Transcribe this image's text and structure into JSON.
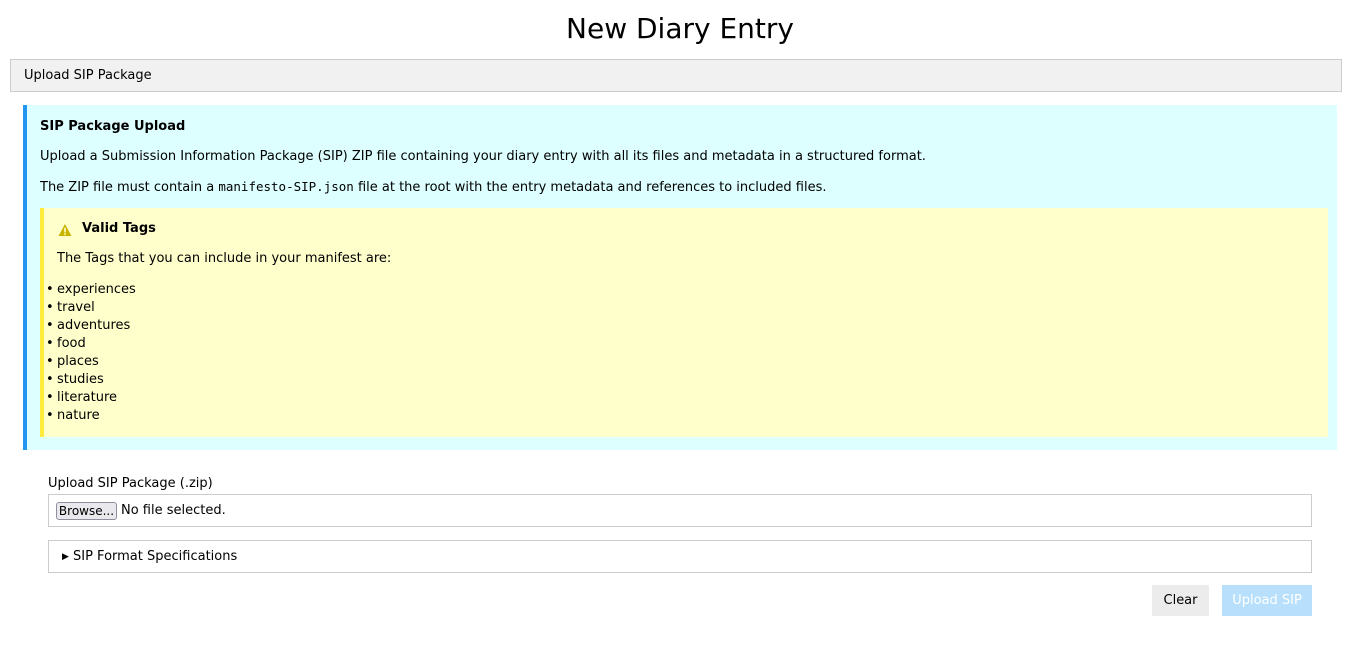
{
  "page": {
    "title": "New Diary Entry"
  },
  "tab": {
    "label": "Upload SIP Package"
  },
  "info": {
    "title": "SIP Package Upload",
    "text1": "Upload a Submission Information Package (SIP) ZIP file containing your diary entry with all its files and metadata in a structured format.",
    "text2_before": "The ZIP file must contain a ",
    "text2_code": "manifesto-SIP.json",
    "text2_after": " file at the root with the entry metadata and references to included files.",
    "accent_color": "#2196f3",
    "background_color": "#ddffff"
  },
  "warning": {
    "icon": "warning-triangle-icon",
    "title": "Valid Tags",
    "text": "The Tags that you can include in your manifest are:",
    "tags": [
      "experiences",
      "travel",
      "adventures",
      "food",
      "places",
      "studies",
      "literature",
      "nature"
    ],
    "accent_color": "#ffeb3b",
    "background_color": "#ffffcc"
  },
  "upload": {
    "label": "Upload SIP Package (.zip)",
    "browse_label": "Browse...",
    "file_status": "No file selected."
  },
  "details": {
    "summary": "SIP Format Specifications"
  },
  "actions": {
    "clear_label": "Clear",
    "upload_label": "Upload SIP",
    "upload_color": "#b8e0fc"
  }
}
